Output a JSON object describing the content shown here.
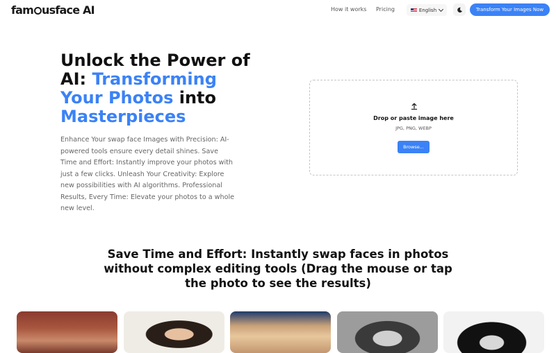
{
  "header": {
    "logo": {
      "pre": "fam",
      "post": "usface AI"
    },
    "nav": {
      "how": "How it works",
      "pricing": "Pricing"
    },
    "language": "English",
    "cta": "Transform Your Images Now"
  },
  "hero": {
    "title_part1": "Unlock the Power of AI: ",
    "title_part2": "Transforming Your Photos",
    "title_part3": " into ",
    "title_part4": "Masterpieces",
    "description": "Enhance Your swap face Images with Precision: AI-powered tools ensure every detail shines. Save Time and Effort: Instantly improve your photos with just a few clicks. Unleash Your Creativity: Explore new possibilities with AI algorithms. Professional Results, Every Time: Elevate your photos to a whole new level."
  },
  "upload": {
    "icon": "upload-icon",
    "title": "Drop or paste image here",
    "formats": "JPG, PNG, WEBP",
    "button": "Browse..."
  },
  "section": {
    "title": "Save Time and Effort: Instantly swap faces in photos without complex editing tools (Drag the mouse or tap the photo to see the results)"
  },
  "gallery": [
    "photo-1",
    "photo-2",
    "photo-3",
    "photo-4",
    "photo-5"
  ],
  "colors": {
    "accent": "#3b82f6",
    "text": "#111111",
    "muted": "#666666"
  }
}
